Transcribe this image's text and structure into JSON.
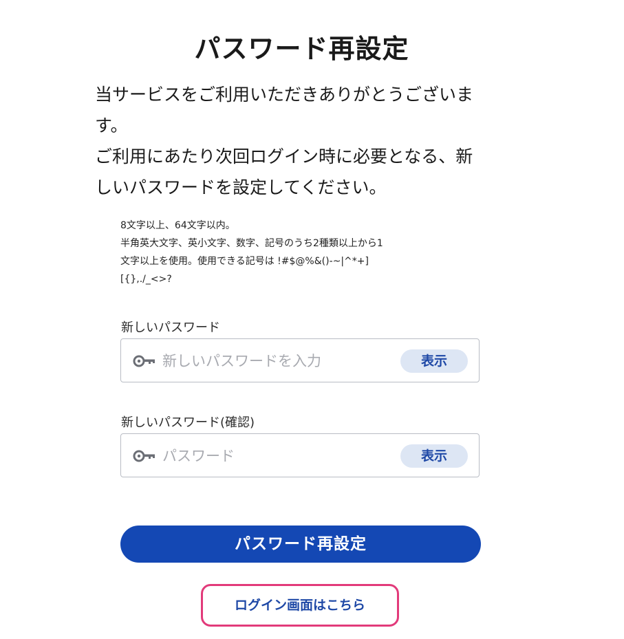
{
  "title": "パスワード再設定",
  "intro": {
    "line1": "当サービスをご利用いただきありがとうございま",
    "line2": "す。",
    "line3": "ご利用にあたり次回ログイン時に必要となる、新",
    "line4": "しいパスワードを設定してください。"
  },
  "rules": {
    "line1": "8文字以上、64文字以内。",
    "line2": "半角英大文字、英小文字、数字、記号のうち2種類以上から1",
    "line3": "文字以上を使用。使用できる記号は !#$@%&()-~|^*+]",
    "line4": "[{},./_<>?"
  },
  "new_password": {
    "label": "新しいパスワード",
    "placeholder": "新しいパスワードを入力",
    "value": "",
    "show_label": "表示",
    "icon": "key-icon"
  },
  "confirm_password": {
    "label": "新しいパスワード(確認)",
    "placeholder": "パスワード",
    "value": "",
    "show_label": "表示",
    "icon": "key-icon"
  },
  "submit_label": "パスワード再設定",
  "login_link_label": "ログイン画面はこちら",
  "colors": {
    "primary": "#1448b4",
    "show_button_bg": "#dde6f4",
    "highlight_border": "#e23a7a"
  }
}
